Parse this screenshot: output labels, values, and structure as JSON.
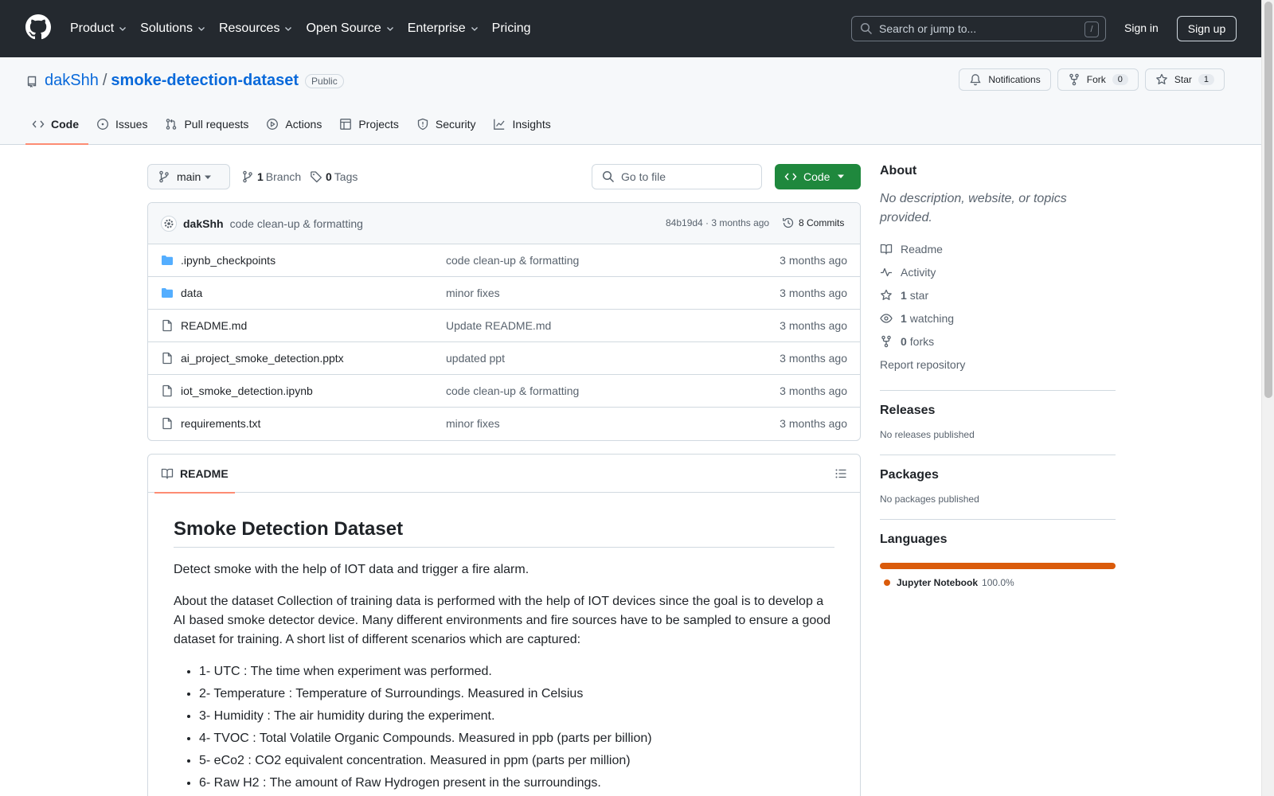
{
  "global_nav": {
    "items": [
      {
        "label": "Product",
        "dropdown": true
      },
      {
        "label": "Solutions",
        "dropdown": true
      },
      {
        "label": "Resources",
        "dropdown": true
      },
      {
        "label": "Open Source",
        "dropdown": true
      },
      {
        "label": "Enterprise",
        "dropdown": true
      },
      {
        "label": "Pricing",
        "dropdown": false
      }
    ],
    "search_placeholder": "Search or jump to...",
    "search_shortcut": "/",
    "sign_in": "Sign in",
    "sign_up": "Sign up"
  },
  "repo": {
    "owner": "dakShh",
    "separator": "/",
    "name": "smoke-detection-dataset",
    "visibility": "Public",
    "notifications_label": "Notifications",
    "fork_label": "Fork",
    "fork_count": "0",
    "star_label": "Star",
    "star_count": "1"
  },
  "tabs": [
    {
      "label": "Code",
      "icon": "code-icon",
      "active": true
    },
    {
      "label": "Issues",
      "icon": "issue-icon"
    },
    {
      "label": "Pull requests",
      "icon": "pull-request-icon"
    },
    {
      "label": "Actions",
      "icon": "play-icon"
    },
    {
      "label": "Projects",
      "icon": "table-icon"
    },
    {
      "label": "Security",
      "icon": "shield-icon"
    },
    {
      "label": "Insights",
      "icon": "graph-icon"
    }
  ],
  "toolbar": {
    "branch": "main",
    "branch_count": "1",
    "branch_label": "Branch",
    "tag_count": "0",
    "tag_label": "Tags",
    "go_to_file": "Go to file",
    "code_button": "Code"
  },
  "latest_commit": {
    "author": "dakShh",
    "message": "code clean-up & formatting",
    "meta": "84b19d4 · 3 months ago",
    "commits_label": "8 Commits"
  },
  "files": [
    {
      "type": "folder",
      "name": ".ipynb_checkpoints",
      "message": "code clean-up & formatting",
      "time": "3 months ago"
    },
    {
      "type": "folder",
      "name": "data",
      "message": "minor fixes",
      "time": "3 months ago"
    },
    {
      "type": "file",
      "name": "README.md",
      "message": "Update README.md",
      "time": "3 months ago"
    },
    {
      "type": "file",
      "name": "ai_project_smoke_detection.pptx",
      "message": "updated ppt",
      "time": "3 months ago"
    },
    {
      "type": "file",
      "name": "iot_smoke_detection.ipynb",
      "message": "code clean-up & formatting",
      "time": "3 months ago"
    },
    {
      "type": "file",
      "name": "requirements.txt",
      "message": "minor fixes",
      "time": "3 months ago"
    }
  ],
  "readme": {
    "tab_label": "README",
    "title": "Smoke Detection Dataset",
    "paragraphs": [
      "Detect smoke with the help of IOT data and trigger a fire alarm.",
      "About the dataset Collection of training data is performed with the help of IOT devices since the goal is to develop a AI based smoke detector device. Many different environments and fire sources have to be sampled to ensure a good dataset for training. A short list of different scenarios which are captured:"
    ],
    "list": [
      "1- UTC : The time when experiment was performed.",
      "2- Temperature : Temperature of Surroundings. Measured in Celsius",
      "3- Humidity : The air humidity during the experiment.",
      "4- TVOC : Total Volatile Organic Compounds. Measured in ppb (parts per billion)",
      "5- eCo2 : CO2 equivalent concentration. Measured in ppm (parts per million)",
      "6- Raw H2 : The amount of Raw Hydrogen present in the surroundings."
    ]
  },
  "sidebar": {
    "about_title": "About",
    "about_desc": "No description, website, or topics provided.",
    "readme": "Readme",
    "activity": "Activity",
    "stars_count": "1",
    "stars_label": "star",
    "watching_count": "1",
    "watching_label": "watching",
    "forks_count": "0",
    "forks_label": "forks",
    "report": "Report repository",
    "releases_title": "Releases",
    "releases_text": "No releases published",
    "packages_title": "Packages",
    "packages_text": "No packages published",
    "languages_title": "Languages",
    "languages": [
      {
        "name": "Jupyter Notebook",
        "percent": "100.0%",
        "color": "#DA5B0B",
        "fraction": 1.0
      }
    ]
  },
  "colors": {
    "header_bg": "#24292f",
    "link": "#0969da",
    "green_button": "#1f883d",
    "active_tab_underline": "#fd8c73"
  }
}
